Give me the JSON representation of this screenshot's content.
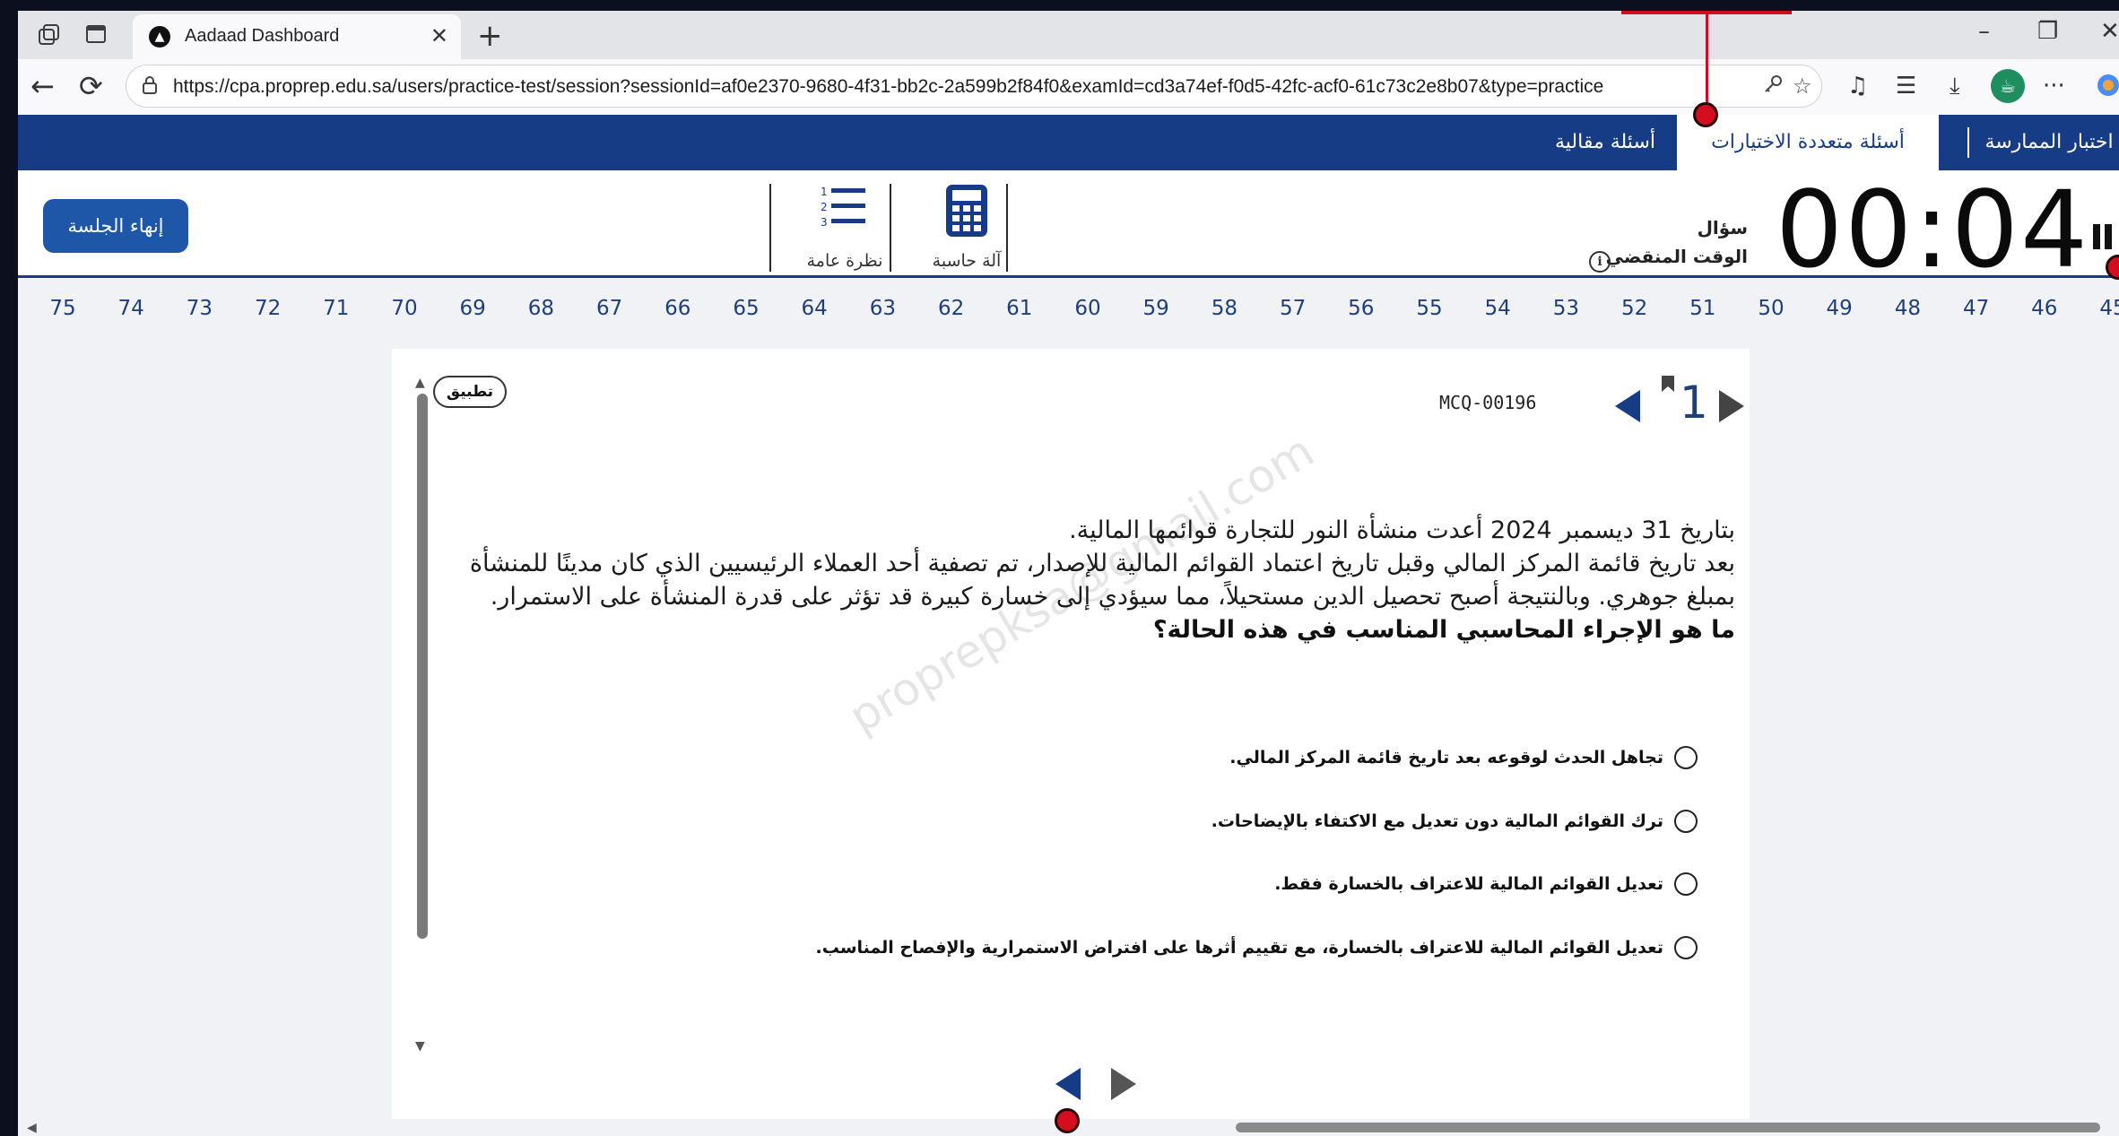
{
  "browser": {
    "tab_title": "Aadaad Dashboard",
    "url": "https://cpa.proprep.edu.sa/users/practice-test/session?sessionId=af0e2370-9680-4f31-bb2c-2a599b2f84f0&examId=cd3a74ef-f0d5-42fc-acf0-61c73c2e8b07&type=practice",
    "icons": {
      "collections": "collections-icon",
      "tab_actions": "tab-actions-icon",
      "back": "←",
      "reload": "⟳",
      "new_tab": "+",
      "tab_close": "✕",
      "minimize": "–",
      "restore": "❐",
      "close": "✕",
      "more": "···"
    }
  },
  "app_nav": {
    "tabs": [
      {
        "label": "اختبار الممارسة",
        "active": false
      },
      {
        "label": "أسئلة متعددة الاختيارات",
        "active": true
      },
      {
        "label": "أسئلة مقالية",
        "active": false
      }
    ]
  },
  "toolbar": {
    "end_session": "إنهاء الجلسة",
    "calculator": "آلة حاسبة",
    "overview": "نظرة عامة",
    "timer": "00:04",
    "timer_question_label": "سؤال",
    "timer_elapsed_label": "الوقت المنقضي",
    "info_glyph": "i"
  },
  "question_numbers": [
    "75",
    "74",
    "73",
    "72",
    "71",
    "70",
    "69",
    "68",
    "67",
    "66",
    "65",
    "64",
    "63",
    "62",
    "61",
    "60",
    "59",
    "58",
    "57",
    "56",
    "55",
    "54",
    "53",
    "52",
    "51",
    "50",
    "49",
    "48",
    "47",
    "46",
    "45"
  ],
  "question": {
    "badge": "تطبيق",
    "code": "MCQ-00196",
    "number": "1",
    "line1": "بتاريخ 31 ديسمبر 2024 أعدت منشأة النور للتجارة قوائمها المالية.",
    "line2": "بعد تاريخ قائمة المركز المالي وقبل تاريخ اعتماد القوائم المالية للإصدار، تم تصفية أحد العملاء الرئيسيين الذي كان مدينًا للمنشأة بمبلغ جوهري. وبالنتيجة أصبح تحصيل الدين مستحيلاً، مما سيؤدي إلى خسارة كبيرة قد تؤثر على قدرة المنشأة على الاستمرار.",
    "prompt": "ما هو الإجراء المحاسبي المناسب في هذه الحالة؟",
    "options": [
      "تجاهل الحدث لوقوعه بعد تاريخ قائمة المركز المالي.",
      "ترك القوائم المالية دون تعديل مع الاكتفاء بالإيضاحات.",
      "تعديل القوائم المالية للاعتراف بالخسارة فقط.",
      "تعديل القوائم المالية للاعتراف بالخسارة، مع تقييم أثرها على افتراض الاستمرارية والإفصاح المناسب."
    ],
    "watermark": "proprepksa@gmail.com"
  },
  "colors": {
    "brand_navy": "#163c85",
    "button_blue": "#1e56a8",
    "number_blue": "#1e3f7a",
    "record_red": "#d40d1f"
  }
}
